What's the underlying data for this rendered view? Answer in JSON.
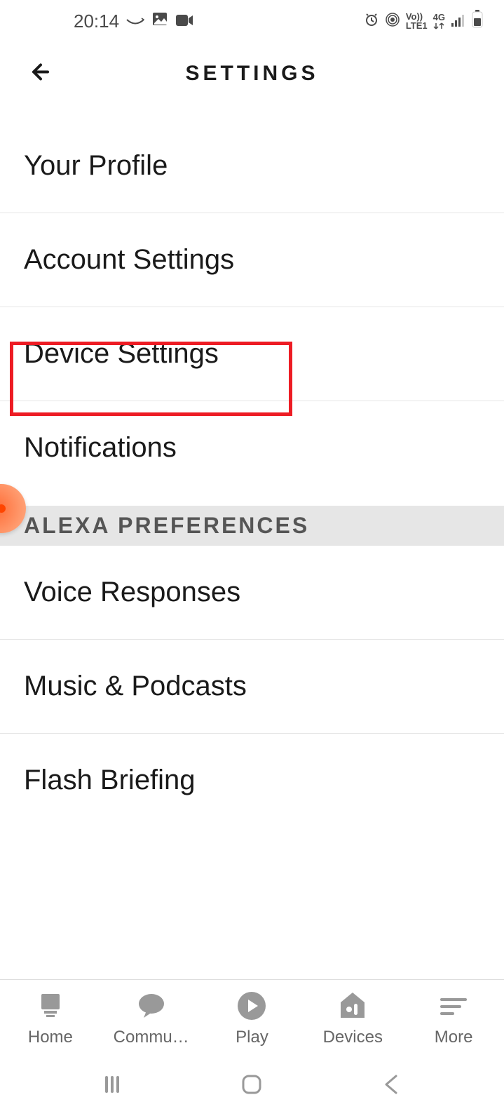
{
  "status": {
    "time": "20:14",
    "network": "4G",
    "volte": "Vo))\nLTE1"
  },
  "header": {
    "title": "SETTINGS"
  },
  "menu": {
    "section1": [
      {
        "label": "Your Profile"
      },
      {
        "label": "Account Settings"
      },
      {
        "label": "Device Settings"
      },
      {
        "label": "Notifications"
      }
    ],
    "section2_header": "ALEXA PREFERENCES",
    "section2": [
      {
        "label": "Voice Responses"
      },
      {
        "label": "Music & Podcasts"
      },
      {
        "label": "Flash Briefing"
      }
    ]
  },
  "nav": {
    "items": [
      {
        "label": "Home"
      },
      {
        "label": "Commu…"
      },
      {
        "label": "Play"
      },
      {
        "label": "Devices"
      },
      {
        "label": "More"
      }
    ]
  }
}
